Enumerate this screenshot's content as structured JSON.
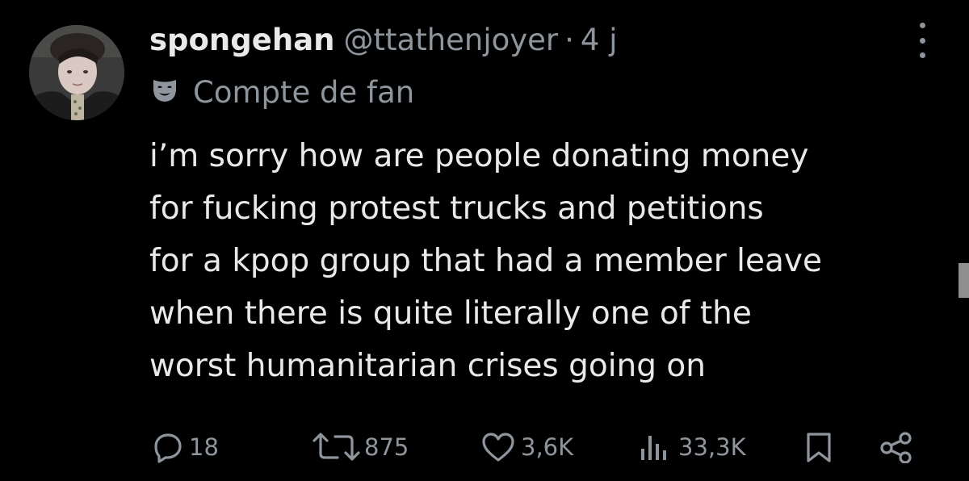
{
  "tweet": {
    "display_name": "spongehan",
    "handle": "@ttathenjoyer",
    "separator": "·",
    "time": "4 j",
    "fan_badge_icon": "mask-icon",
    "fan_label": "Compte de fan",
    "text_lines": [
      "i’m sorry how are people donating money",
      "for fucking protest trucks and petitions",
      "for a kpop group that had a member leave",
      "when there is quite literally one of the",
      "worst humanitarian crises going on"
    ]
  },
  "actions": {
    "replies": "18",
    "retweets": "875",
    "likes": "3,6K",
    "views": "33,3K"
  },
  "colors": {
    "background": "#000000",
    "text": "#e7e9ea",
    "secondary": "#8f959c"
  }
}
